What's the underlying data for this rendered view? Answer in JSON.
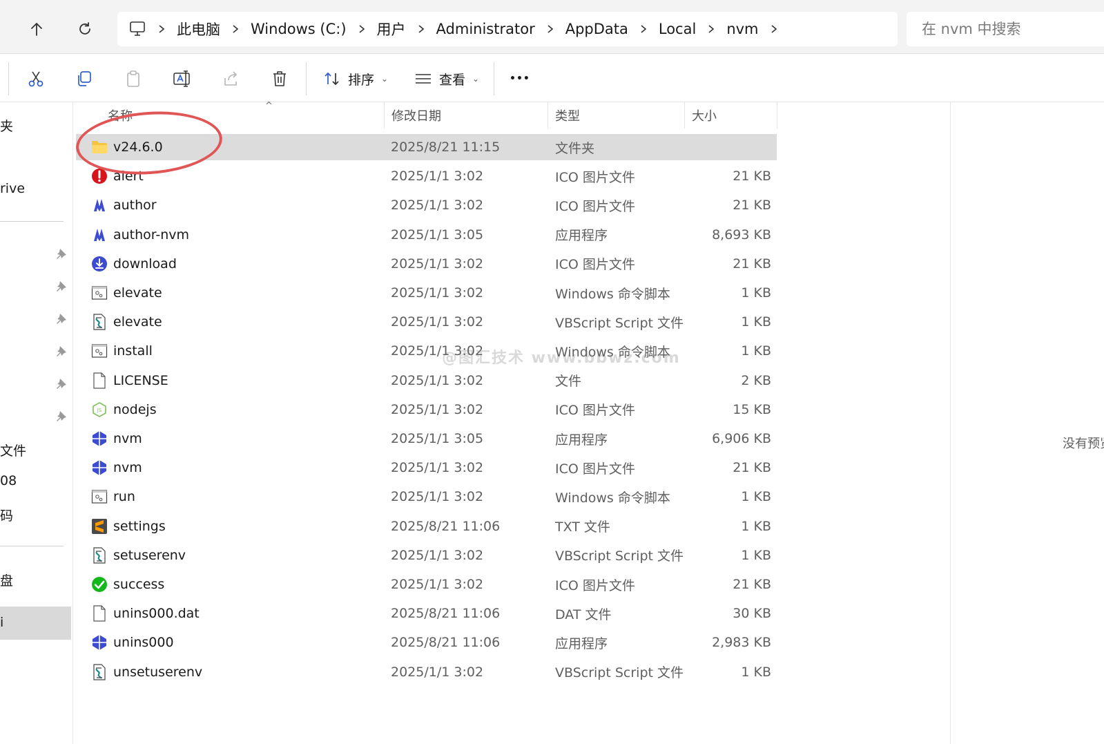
{
  "address_bar": {
    "crumbs": [
      "此电脑",
      "Windows (C:)",
      "用户",
      "Administrator",
      "AppData",
      "Local",
      "nvm"
    ],
    "search_placeholder": "在 nvm 中搜索"
  },
  "toolbar": {
    "sort_label": "排序",
    "view_label": "查看",
    "more_label": "•••"
  },
  "sidebar": {
    "fragments": [
      "夹",
      "rive",
      "文件",
      "08",
      "码",
      "盘",
      "i"
    ]
  },
  "columns": {
    "name": "名称",
    "date": "修改日期",
    "type": "类型",
    "size": "大小"
  },
  "files": [
    {
      "name": "v24.6.0",
      "date": "2025/8/21 11:15",
      "type": "文件夹",
      "size": "",
      "icon": "folder-icon",
      "selected": true
    },
    {
      "name": "alert",
      "date": "2025/1/1 3:02",
      "type": "ICO 图片文件",
      "size": "21 KB",
      "icon": "alert-icon"
    },
    {
      "name": "author",
      "date": "2025/1/1 3:02",
      "type": "ICO 图片文件",
      "size": "21 KB",
      "icon": "author-icon"
    },
    {
      "name": "author-nvm",
      "date": "2025/1/1 3:05",
      "type": "应用程序",
      "size": "8,693 KB",
      "icon": "author-icon"
    },
    {
      "name": "download",
      "date": "2025/1/1 3:02",
      "type": "ICO 图片文件",
      "size": "21 KB",
      "icon": "download-icon"
    },
    {
      "name": "elevate",
      "date": "2025/1/1 3:02",
      "type": "Windows 命令脚本",
      "size": "1 KB",
      "icon": "script-cmd-icon"
    },
    {
      "name": "elevate",
      "date": "2025/1/1 3:02",
      "type": "VBScript Script 文件",
      "size": "1 KB",
      "icon": "vbscript-icon"
    },
    {
      "name": "install",
      "date": "2025/1/1 3:02",
      "type": "Windows 命令脚本",
      "size": "1 KB",
      "icon": "script-cmd-icon"
    },
    {
      "name": "LICENSE",
      "date": "2025/1/1 3:02",
      "type": "文件",
      "size": "2 KB",
      "icon": "file-icon"
    },
    {
      "name": "nodejs",
      "date": "2025/1/1 3:02",
      "type": "ICO 图片文件",
      "size": "15 KB",
      "icon": "nodejs-icon"
    },
    {
      "name": "nvm",
      "date": "2025/1/1 3:05",
      "type": "应用程序",
      "size": "6,906 KB",
      "icon": "nvm-app-icon"
    },
    {
      "name": "nvm",
      "date": "2025/1/1 3:02",
      "type": "ICO 图片文件",
      "size": "21 KB",
      "icon": "nvm-app-icon"
    },
    {
      "name": "run",
      "date": "2025/1/1 3:02",
      "type": "Windows 命令脚本",
      "size": "1 KB",
      "icon": "script-cmd-icon"
    },
    {
      "name": "settings",
      "date": "2025/8/21 11:06",
      "type": "TXT 文件",
      "size": "1 KB",
      "icon": "sublime-icon"
    },
    {
      "name": "setuserenv",
      "date": "2025/1/1 3:02",
      "type": "VBScript Script 文件",
      "size": "1 KB",
      "icon": "vbscript-icon"
    },
    {
      "name": "success",
      "date": "2025/1/1 3:02",
      "type": "ICO 图片文件",
      "size": "21 KB",
      "icon": "success-icon"
    },
    {
      "name": "unins000.dat",
      "date": "2025/8/21 11:06",
      "type": "DAT 文件",
      "size": "30 KB",
      "icon": "file-icon"
    },
    {
      "name": "unins000",
      "date": "2025/8/21 11:06",
      "type": "应用程序",
      "size": "2,983 KB",
      "icon": "nvm-app-icon"
    },
    {
      "name": "unsetuserenv",
      "date": "2025/1/1 3:02",
      "type": "VBScript Script 文件",
      "size": "1 KB",
      "icon": "vbscript-icon"
    }
  ],
  "preview": {
    "text": "没有预览"
  },
  "watermark": "@图汇技术 www.bbwz.com",
  "colors": {
    "selection": "#dcdcdc",
    "annotation": "#e05555",
    "folder": "#f5c542",
    "nvm_blue": "#3c4bd0"
  }
}
